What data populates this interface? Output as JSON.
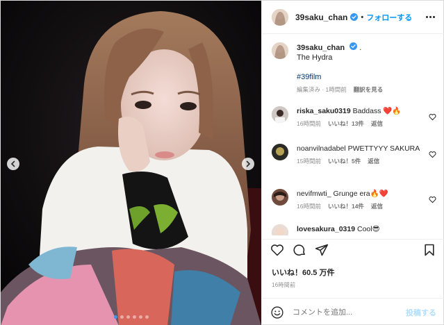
{
  "post": {
    "username": "39saku_chan",
    "follow_label": "フォローする",
    "separator": "•"
  },
  "caption": {
    "username": "39saku_chan",
    "suffix": ".",
    "line1": "The Hydra",
    "hashtag": "#39film",
    "meta_edited": "編集済み · 1時間前",
    "meta_translate": "翻訳を見る"
  },
  "comments": [
    {
      "username": "riska_saku0319",
      "text": "Baddass ❤️🔥",
      "time": "16時間前",
      "likes": "いいね！13件",
      "reply": "返信"
    },
    {
      "username": "noanvilnadabel",
      "text": "PWETTYYY SAKURA",
      "time": "15時間前",
      "likes": "いいね！5件",
      "reply": "返信"
    },
    {
      "username": "nevifmwti_",
      "text": "Grunge era🔥❤️",
      "time": "16時間前",
      "likes": "いいね！14件",
      "reply": "返信"
    },
    {
      "username": "lovesakura_0319",
      "text": "Cool😎",
      "time": "",
      "likes": "",
      "reply": ""
    }
  ],
  "stats": {
    "likes": "いいね！60.5 万件",
    "time_ago": "16時間前"
  },
  "add_comment": {
    "placeholder": "コメントを追加...",
    "post_label": "投稿する"
  },
  "colors": {
    "accent": "#0095f6",
    "verified": "#3897f0",
    "heart_red": "#ed4956",
    "link": "#00376b"
  },
  "icons": [
    "verified-icon",
    "more-icon",
    "heart-icon",
    "comment-icon",
    "share-icon",
    "bookmark-icon",
    "emoji-icon",
    "chevron-left-icon",
    "chevron-right-icon"
  ],
  "carousel": {
    "dots": 6,
    "active": 0
  }
}
